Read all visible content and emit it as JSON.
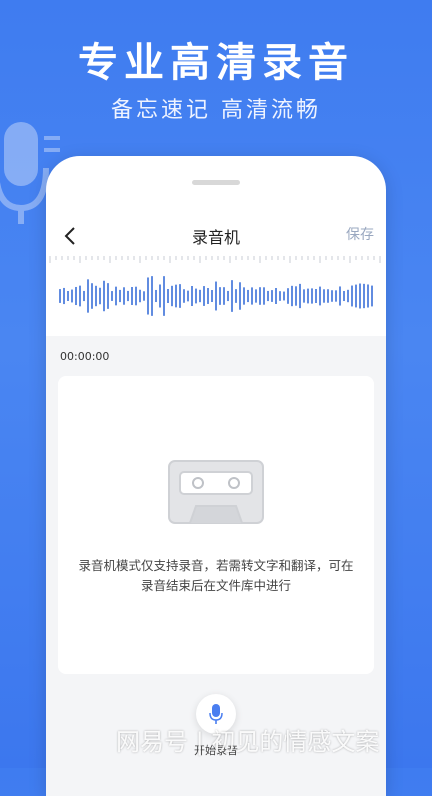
{
  "promo": {
    "title": "专业高清录音",
    "subtitle": "备忘速记  高清流畅"
  },
  "recorder": {
    "title": "录音机",
    "save_label": "保存",
    "timer": "00:00:00",
    "hint": "录音机模式仅支持录音，若需转文字和翻译，可在录音结束后在文件库中进行",
    "record_label": "开始录音"
  },
  "watermark": "网易号 | 初见的情感文案",
  "colors": {
    "accent": "#3f7cf0",
    "wave": "#3a6fd8"
  },
  "icons": {
    "back": "chevron-left-icon",
    "mic": "microphone-icon",
    "cassette": "cassette-icon"
  }
}
